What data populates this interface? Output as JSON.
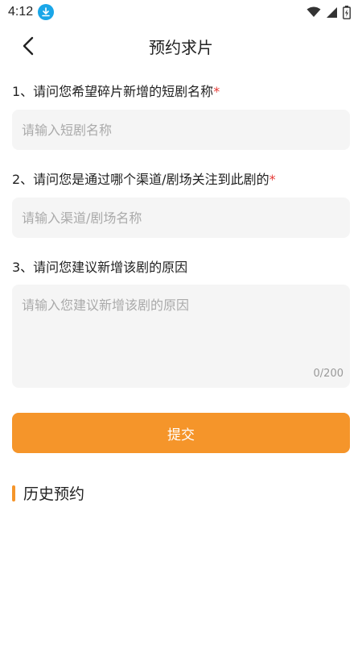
{
  "status_bar": {
    "time": "4:12",
    "icons": [
      "download-icon",
      "wifi-icon",
      "signal-icon",
      "battery-icon"
    ]
  },
  "nav": {
    "title": "预约求片",
    "back_icon": "chevron-left-icon"
  },
  "form": {
    "q1": {
      "label": "1、请问您希望碎片新增的短剧名称",
      "required_mark": "*",
      "placeholder": "请输入短剧名称"
    },
    "q2": {
      "label": "2、请问您是通过哪个渠道/剧场关注到此剧的",
      "required_mark": "*",
      "placeholder": "请输入渠道/剧场名称"
    },
    "q3": {
      "label": "3、请问您建议新增该剧的原因",
      "placeholder": "请输入您建议新增该剧的原因",
      "counter": "0/200"
    },
    "submit_label": "提交"
  },
  "history": {
    "title": "历史预约"
  },
  "colors": {
    "accent": "#f5952a",
    "required": "#e53935",
    "input_bg": "#f5f5f5",
    "download_badge": "#1aa6e8"
  }
}
